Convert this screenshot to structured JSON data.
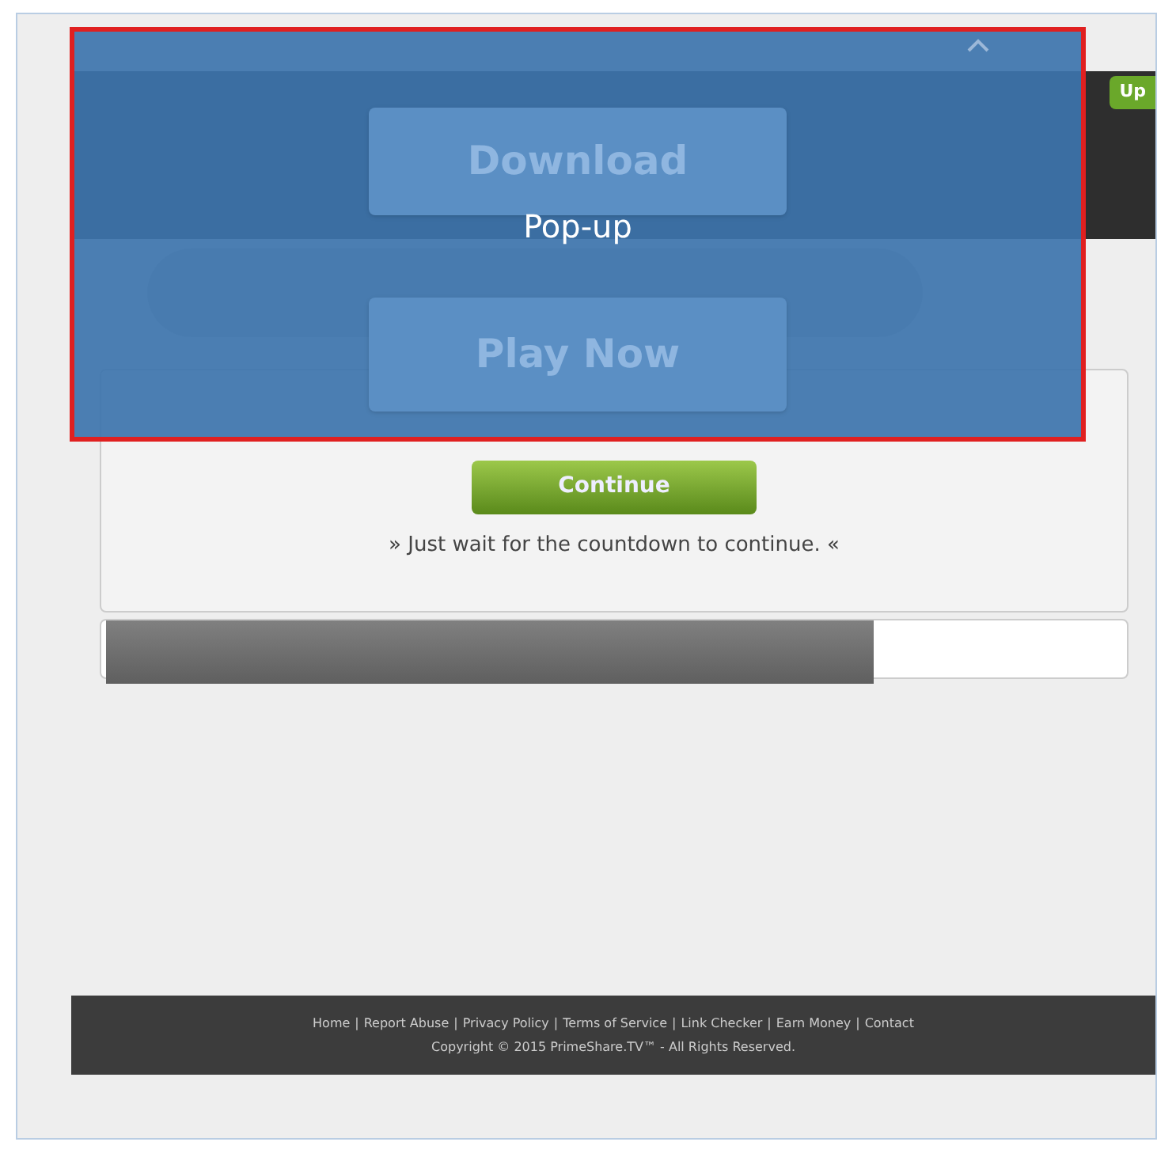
{
  "header": {
    "signup_button": "Up"
  },
  "popup": {
    "label": "Pop-up",
    "buttons": [
      {
        "label": "Download"
      },
      {
        "label": "Play Now"
      }
    ]
  },
  "card": {
    "button": "Continue",
    "message": "» Just wait for the countdown to continue. «"
  },
  "progress": {
    "level": 0.75
  },
  "footer": {
    "separator": "|",
    "links": [
      "Home",
      "Report Abuse",
      "Privacy Policy",
      "Terms of Service",
      "Link Checker",
      "Earn Money",
      "Contact"
    ],
    "copyright": "Copyright © 2015 PrimeShare.TV™ - All Rights Reserved."
  }
}
